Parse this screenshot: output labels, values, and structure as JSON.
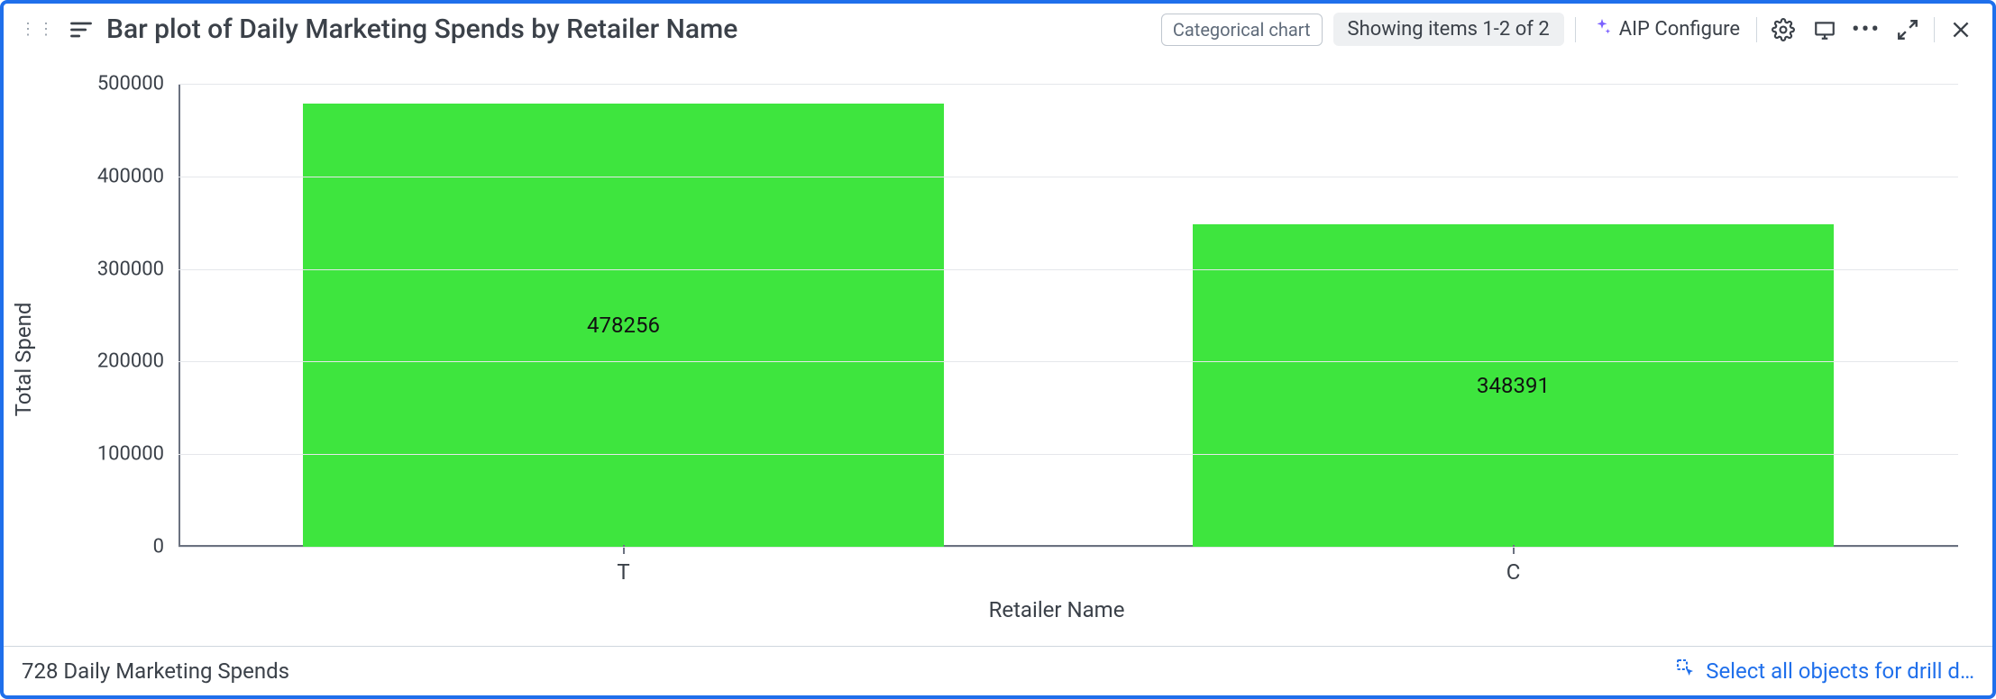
{
  "header": {
    "title": "Bar plot of Daily Marketing Spends by Retailer Name",
    "chart_type_chip": "Categorical chart",
    "items_pill": "Showing items 1-2 of 2",
    "aip_label": "AIP Configure"
  },
  "footer": {
    "status": "728 Daily Marketing Spends",
    "drill_label": "Select all objects for drill d…"
  },
  "chart_data": {
    "type": "bar",
    "title": "Bar plot of Daily Marketing Spends by Retailer Name",
    "xlabel": "Retailer Name",
    "ylabel": "Total Spend",
    "categories": [
      "T",
      "C"
    ],
    "values": [
      478256,
      348391
    ],
    "ylim": [
      0,
      500000
    ],
    "yticks": [
      0,
      100000,
      200000,
      300000,
      400000,
      500000
    ],
    "bar_color": "#3ee53e"
  }
}
